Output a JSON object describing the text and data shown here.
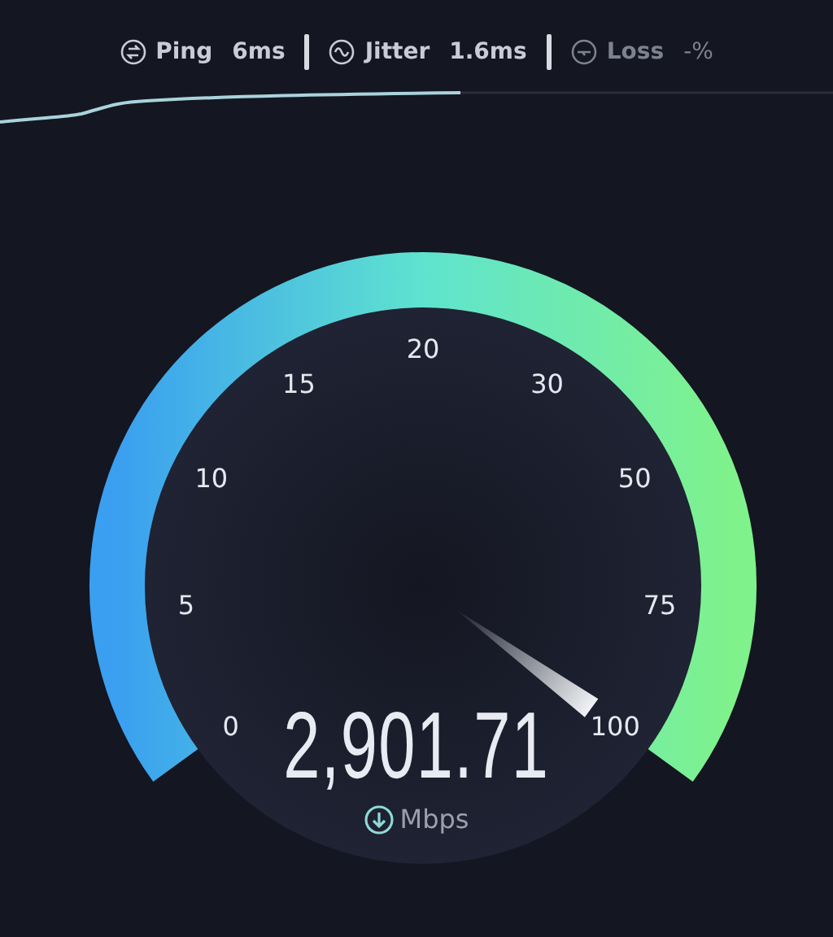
{
  "stats": [
    {
      "kind": "ping",
      "label": "Ping",
      "value": "6ms",
      "disabled": false
    },
    {
      "kind": "jitter",
      "label": "Jitter",
      "value": "1.6ms",
      "disabled": false
    },
    {
      "kind": "loss",
      "label": "Loss",
      "value": "-%",
      "disabled": true
    }
  ],
  "gauge": {
    "scale": [
      "0",
      "5",
      "10",
      "15",
      "20",
      "30",
      "50",
      "75",
      "100"
    ],
    "reading": "2,901.71",
    "unit": "Mbps"
  }
}
